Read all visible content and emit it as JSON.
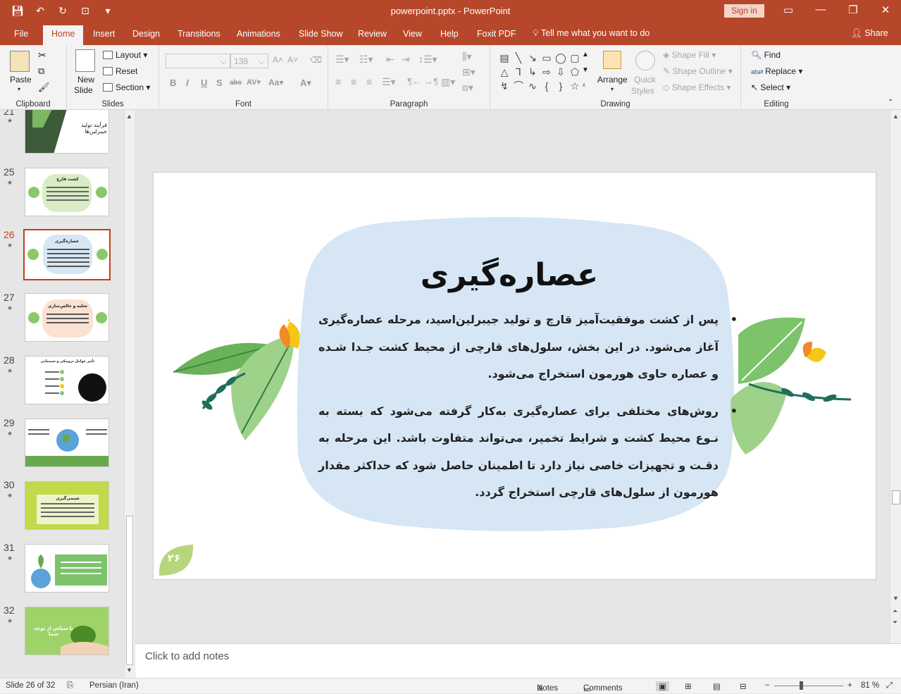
{
  "window": {
    "title": "powerpoint.pptx  -  PowerPoint",
    "sign_in": "Sign in",
    "minimize": "—",
    "restore": "❐",
    "close": "✕"
  },
  "tabs": [
    "File",
    "Home",
    "Insert",
    "Design",
    "Transitions",
    "Animations",
    "Slide Show",
    "Review",
    "View",
    "Help",
    "Foxit PDF"
  ],
  "active_tab": "Home",
  "tell_me": "Tell me what you want to do",
  "share": "Share",
  "ribbon": {
    "clipboard": {
      "label": "Clipboard",
      "paste": "Paste"
    },
    "slides": {
      "label": "Slides",
      "new_slide_1": "New",
      "new_slide_2": "Slide",
      "layout": "Layout",
      "reset": "Reset",
      "section": "Section"
    },
    "font": {
      "label": "Font",
      "size": "138"
    },
    "paragraph": {
      "label": "Paragraph"
    },
    "drawing": {
      "label": "Drawing",
      "arrange": "Arrange",
      "quick_styles_1": "Quick",
      "quick_styles_2": "Styles",
      "shape_fill": "Shape Fill",
      "shape_outline": "Shape Outline",
      "shape_effects": "Shape Effects"
    },
    "editing": {
      "label": "Editing",
      "find": "Find",
      "replace": "Replace",
      "select": "Select"
    }
  },
  "thumbnails": [
    {
      "num": "21",
      "title": "فرآیند تولید جیبرلین‌ها"
    },
    {
      "num": "25",
      "title": "کشت قارچ"
    },
    {
      "num": "26",
      "title": "عصاره‌گیری"
    },
    {
      "num": "27",
      "title": "تخلیه و خالص‌سازی"
    },
    {
      "num": "28",
      "title": "تأثیر عوامل تروپیکی و شیمیایی"
    },
    {
      "num": "29",
      "title": ""
    },
    {
      "num": "30",
      "title": "شیمی‌گیری"
    },
    {
      "num": "31",
      "title": ""
    },
    {
      "num": "32",
      "title": "با سپاس از توجه شما"
    }
  ],
  "slide": {
    "title": "عصاره‌گیری",
    "bullets": [
      "پس از کشت موفقیت‌آمیز قارچ و تولید جیبرلین‌اسید، مرحله عصاره‌گیری آغاز می‌شود. در این بخش، سلول‌های قارچی از محیط کشت جـدا شـده و عصاره حاوی هورمون استخراج می‌شود.",
      "روش‌های مختلفی برای عصاره‌گیری به‌کار گرفته می‌شود که بسته به نـوع محیط کشت و شرایط تخمیر، می‌تواند متفاوت باشد. این مرحله به دقـت و تجهیزات خاصی نیاز دارد تا اطمینان حاصل شود که حداکثر مقدار هورمون از سلول‌های قارچی استخراج گردد."
    ],
    "page_number": "۲۶"
  },
  "notes_placeholder": "Click to add notes",
  "status": {
    "slide_of": "Slide 26 of 32",
    "language": "Persian (Iran)",
    "notes": "Notes",
    "comments": "Comments",
    "zoom": "81 %"
  },
  "colors": {
    "brand": "#b7472a",
    "active_thumb": "#c43e1c",
    "blob": "#d6e6f5",
    "leaf_green": "#7cc36b",
    "leaf_dark": "#1f6e5c",
    "flower_yellow": "#f5c518",
    "flower_orange": "#f08a24"
  }
}
